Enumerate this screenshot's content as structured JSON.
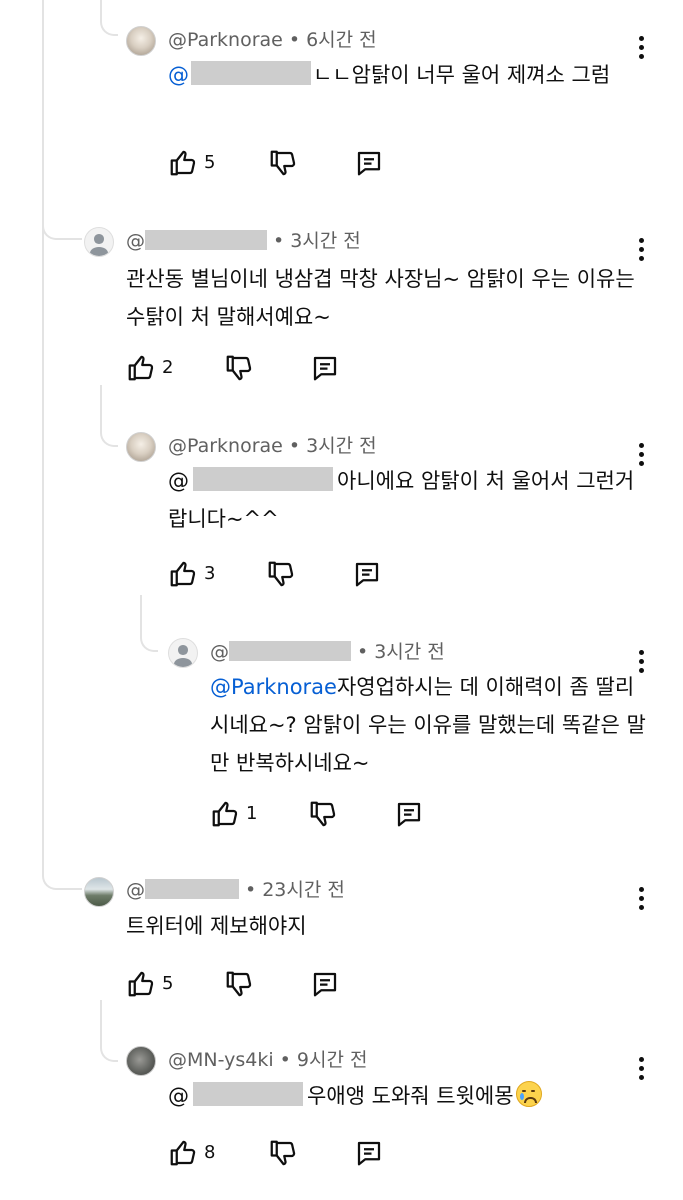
{
  "comments": [
    {
      "handle": "@Parknorae",
      "time": "6시간 전",
      "mention": "@",
      "text": "ㄴㄴ암탉이 너무 울어 제껴소 그럼",
      "likes": "5"
    },
    {
      "handle": "@",
      "time": "3시간 전",
      "text": "관산동 별님이네 냉삼겹 막창 사장님~ 암탉이 우는 이유는 수탉이 처 말해서예요~",
      "likes": "2"
    },
    {
      "handle": "@Parknorae",
      "time": "3시간 전",
      "mention": "@",
      "text": "아니에요 암탉이 처 울어서 그런거랍니다~^^",
      "likes": "3"
    },
    {
      "handle": "@",
      "time": "3시간 전",
      "mention": "@Parknorae",
      "text": "자영업하시는 데 이해력이 좀 딸리시네요~? 암탉이 우는 이유를 말했는데 똑같은 말만 반복하시네요~",
      "likes": "1"
    },
    {
      "handle": "@",
      "time": "23시간 전",
      "text": "트위터에 제보해야지",
      "likes": "5"
    },
    {
      "handle": "@MN-ys4ki",
      "time": "9시간 전",
      "mention": "@",
      "text": "우애앵 도와줘 트윗에몽",
      "emoji": "crying-face-emoji",
      "likes": "8"
    }
  ],
  "meta_separator": "•",
  "colors": {
    "mention": "#065fd4",
    "secondary_text": "#606060",
    "thread_line": "#e3e3e3",
    "redaction": "#cdcdcd"
  },
  "icons": [
    "like-icon",
    "dislike-icon",
    "reply-icon",
    "more-vert-icon"
  ]
}
